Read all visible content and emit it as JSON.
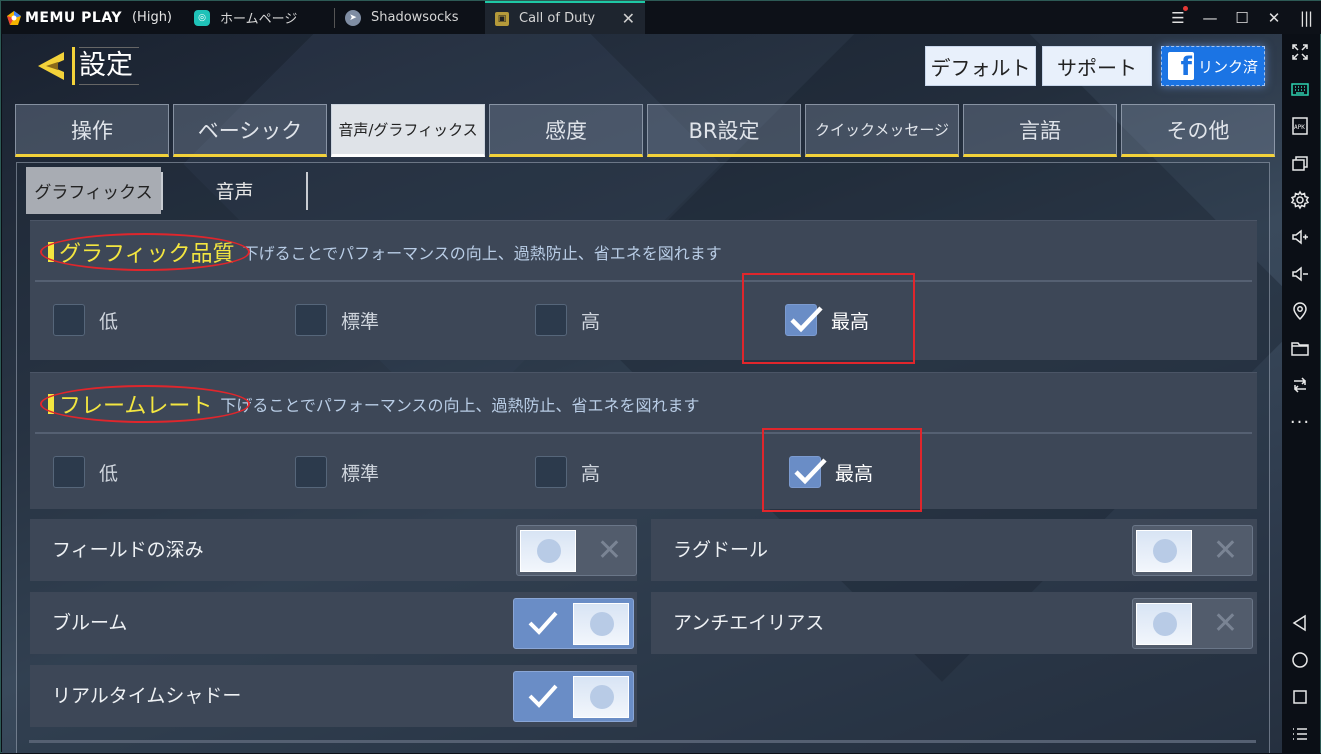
{
  "titlebar": {
    "app_name": "MEMU PLAY",
    "quality": "(High)",
    "tabs": [
      {
        "label": "ホームページ",
        "icon": "home-app-icon"
      },
      {
        "label": "Shadowsocks",
        "icon": "paper-plane-icon"
      },
      {
        "label": "Call of Duty",
        "icon": "game-icon",
        "active": true
      }
    ],
    "close_tab": "✕",
    "window_controls": [
      "menu",
      "minimize",
      "maximize",
      "close",
      "sidebar-toggle"
    ]
  },
  "sidebar": {
    "items": [
      "fullscreen",
      "keyboard-mapping",
      "apk-install",
      "multi-instance",
      "settings",
      "volume-up",
      "volume-down",
      "location",
      "folder",
      "sync",
      "more"
    ],
    "nav": [
      "back",
      "home",
      "recent-apps",
      "menu"
    ]
  },
  "header": {
    "back_title": "設定",
    "default_btn": "デフォルト",
    "support_btn": "サポート",
    "fb_btn": "リンク済",
    "fb_letter": "f"
  },
  "main_tabs": [
    {
      "label": "操作",
      "active": false
    },
    {
      "label": "ベーシック",
      "active": false
    },
    {
      "label": "音声/グラフィックス",
      "active": true
    },
    {
      "label": "感度",
      "active": false
    },
    {
      "label": "BR設定",
      "active": false
    },
    {
      "label": "クイックメッセージ",
      "active": false
    },
    {
      "label": "言語",
      "active": false
    },
    {
      "label": "その他",
      "active": false
    }
  ],
  "sub_tabs": [
    {
      "label": "グラフィックス",
      "active": true
    },
    {
      "label": "音声",
      "active": false
    }
  ],
  "graphics_quality": {
    "title": "グラフィック品質",
    "description": "下げることでパフォーマンスの向上、過熱防止、省エネを図れます",
    "options": [
      {
        "label": "低",
        "checked": false
      },
      {
        "label": "標準",
        "checked": false
      },
      {
        "label": "高",
        "checked": false
      },
      {
        "label": "最高",
        "checked": true
      }
    ]
  },
  "frame_rate": {
    "title": "フレームレート",
    "description": "下げることでパフォーマンスの向上、過熱防止、省エネを図れます",
    "options": [
      {
        "label": "低",
        "checked": false
      },
      {
        "label": "標準",
        "checked": false
      },
      {
        "label": "高",
        "checked": false
      },
      {
        "label": "最高",
        "checked": true
      }
    ]
  },
  "toggles": [
    {
      "label": "フィールドの深み",
      "on": false
    },
    {
      "label": "ラグドール",
      "on": false
    },
    {
      "label": "ブルーム",
      "on": true
    },
    {
      "label": "アンチエイリアス",
      "on": false
    },
    {
      "label": "リアルタイムシャドー",
      "on": true
    }
  ],
  "colors": {
    "accent_yellow": "#f3e640",
    "annotation_red": "#e0262c",
    "checkbox_checked": "#6a8dc6",
    "facebook_blue": "#1b74e4",
    "active_tab_indicator": "#1ec8a5"
  }
}
